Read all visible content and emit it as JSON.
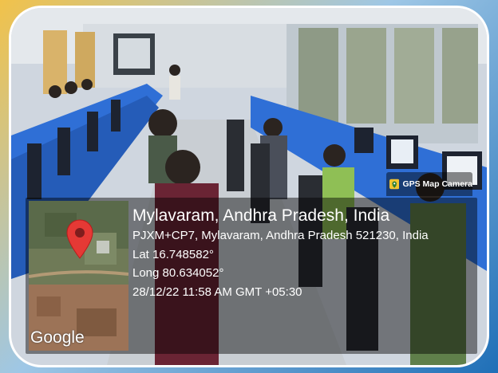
{
  "stamp": {
    "app_name": "GPS Map Camera",
    "title": "Mylavaram, Andhra Pradesh, India",
    "address": "PJXM+CP7, Mylavaram, Andhra Pradesh 521230, India",
    "latitude": "Lat 16.748582°",
    "longitude": "Long 80.634052°",
    "datetime": "28/12/22 11:58 AM GMT +05:30"
  },
  "map": {
    "brand": "Google",
    "pin_color": "#e53935"
  },
  "colors": {
    "desk_blue": "#2f6fd6",
    "overlay": "rgba(0,0,0,0.45)"
  }
}
